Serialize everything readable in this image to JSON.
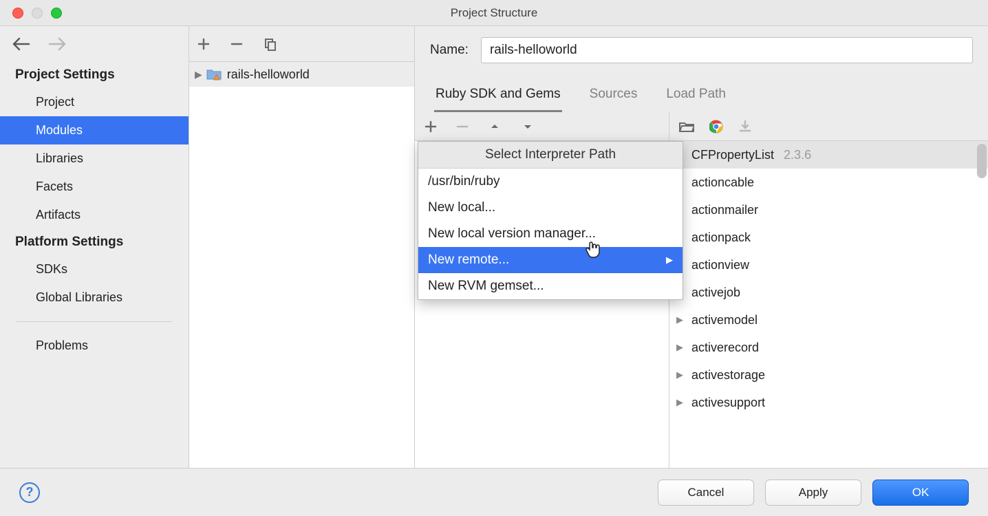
{
  "window": {
    "title": "Project Structure"
  },
  "sidebar": {
    "section1": "Project Settings",
    "items1": [
      "Project",
      "Modules",
      "Libraries",
      "Facets",
      "Artifacts"
    ],
    "selected1": 1,
    "section2": "Platform Settings",
    "items2": [
      "SDKs",
      "Global Libraries"
    ],
    "problems": "Problems"
  },
  "module_tree": {
    "items": [
      {
        "label": "rails-helloworld"
      }
    ]
  },
  "detail": {
    "name_label": "Name:",
    "name_value": "rails-helloworld",
    "tabs": [
      "Ruby SDK and Gems",
      "Sources",
      "Load Path"
    ],
    "active_tab": 0
  },
  "popup": {
    "title": "Select Interpreter Path",
    "items": [
      {
        "label": "/usr/bin/ruby",
        "has_sub": false
      },
      {
        "label": "New local...",
        "has_sub": false
      },
      {
        "label": "New local version manager...",
        "has_sub": false
      },
      {
        "label": "New remote...",
        "has_sub": true
      },
      {
        "label": "New RVM gemset...",
        "has_sub": false
      }
    ],
    "selected": 3
  },
  "gems": [
    {
      "name": "CFPropertyList",
      "ver": "2.3.6",
      "expand": false,
      "sel": true
    },
    {
      "name": "actioncable",
      "ver": "",
      "expand": true
    },
    {
      "name": "actionmailer",
      "ver": "",
      "expand": true
    },
    {
      "name": "actionpack",
      "ver": "",
      "expand": true
    },
    {
      "name": "actionview",
      "ver": "",
      "expand": true
    },
    {
      "name": "activejob",
      "ver": "",
      "expand": true
    },
    {
      "name": "activemodel",
      "ver": "",
      "expand": true
    },
    {
      "name": "activerecord",
      "ver": "",
      "expand": true
    },
    {
      "name": "activestorage",
      "ver": "",
      "expand": true
    },
    {
      "name": "activesupport",
      "ver": "",
      "expand": true
    }
  ],
  "footer": {
    "cancel": "Cancel",
    "apply": "Apply",
    "ok": "OK"
  }
}
